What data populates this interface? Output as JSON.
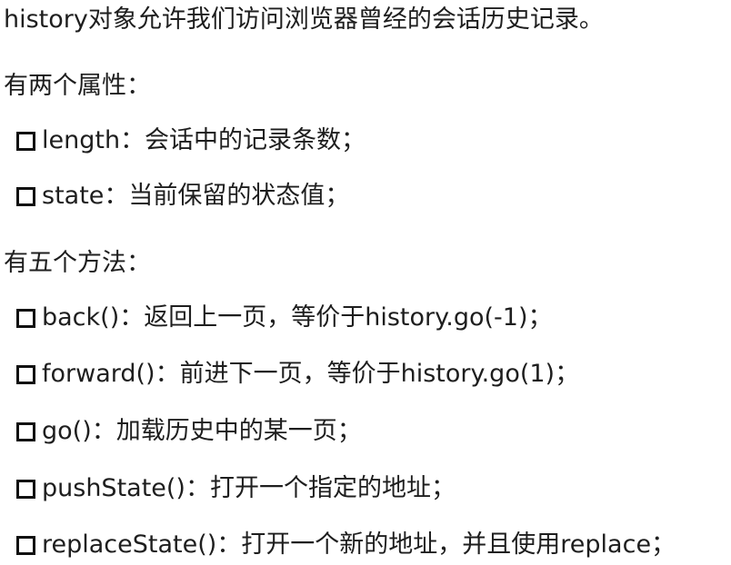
{
  "intro": "history对象允许我们访问浏览器曾经的会话历史记录。",
  "properties": {
    "heading": "有两个属性：",
    "items": [
      {
        "text": "length：会话中的记录条数；"
      },
      {
        "text": "state：当前保留的状态值；"
      }
    ]
  },
  "methods": {
    "heading": "有五个方法：",
    "items": [
      {
        "text": "back()：返回上一页，等价于history.go(-1)；"
      },
      {
        "text": "forward()：前进下一页，等价于history.go(1)；"
      },
      {
        "text": "go()：加载历史中的某一页；"
      },
      {
        "text": "pushState()：打开一个指定的地址；"
      },
      {
        "text": "replaceState()：打开一个新的地址，并且使用replace；"
      }
    ]
  }
}
